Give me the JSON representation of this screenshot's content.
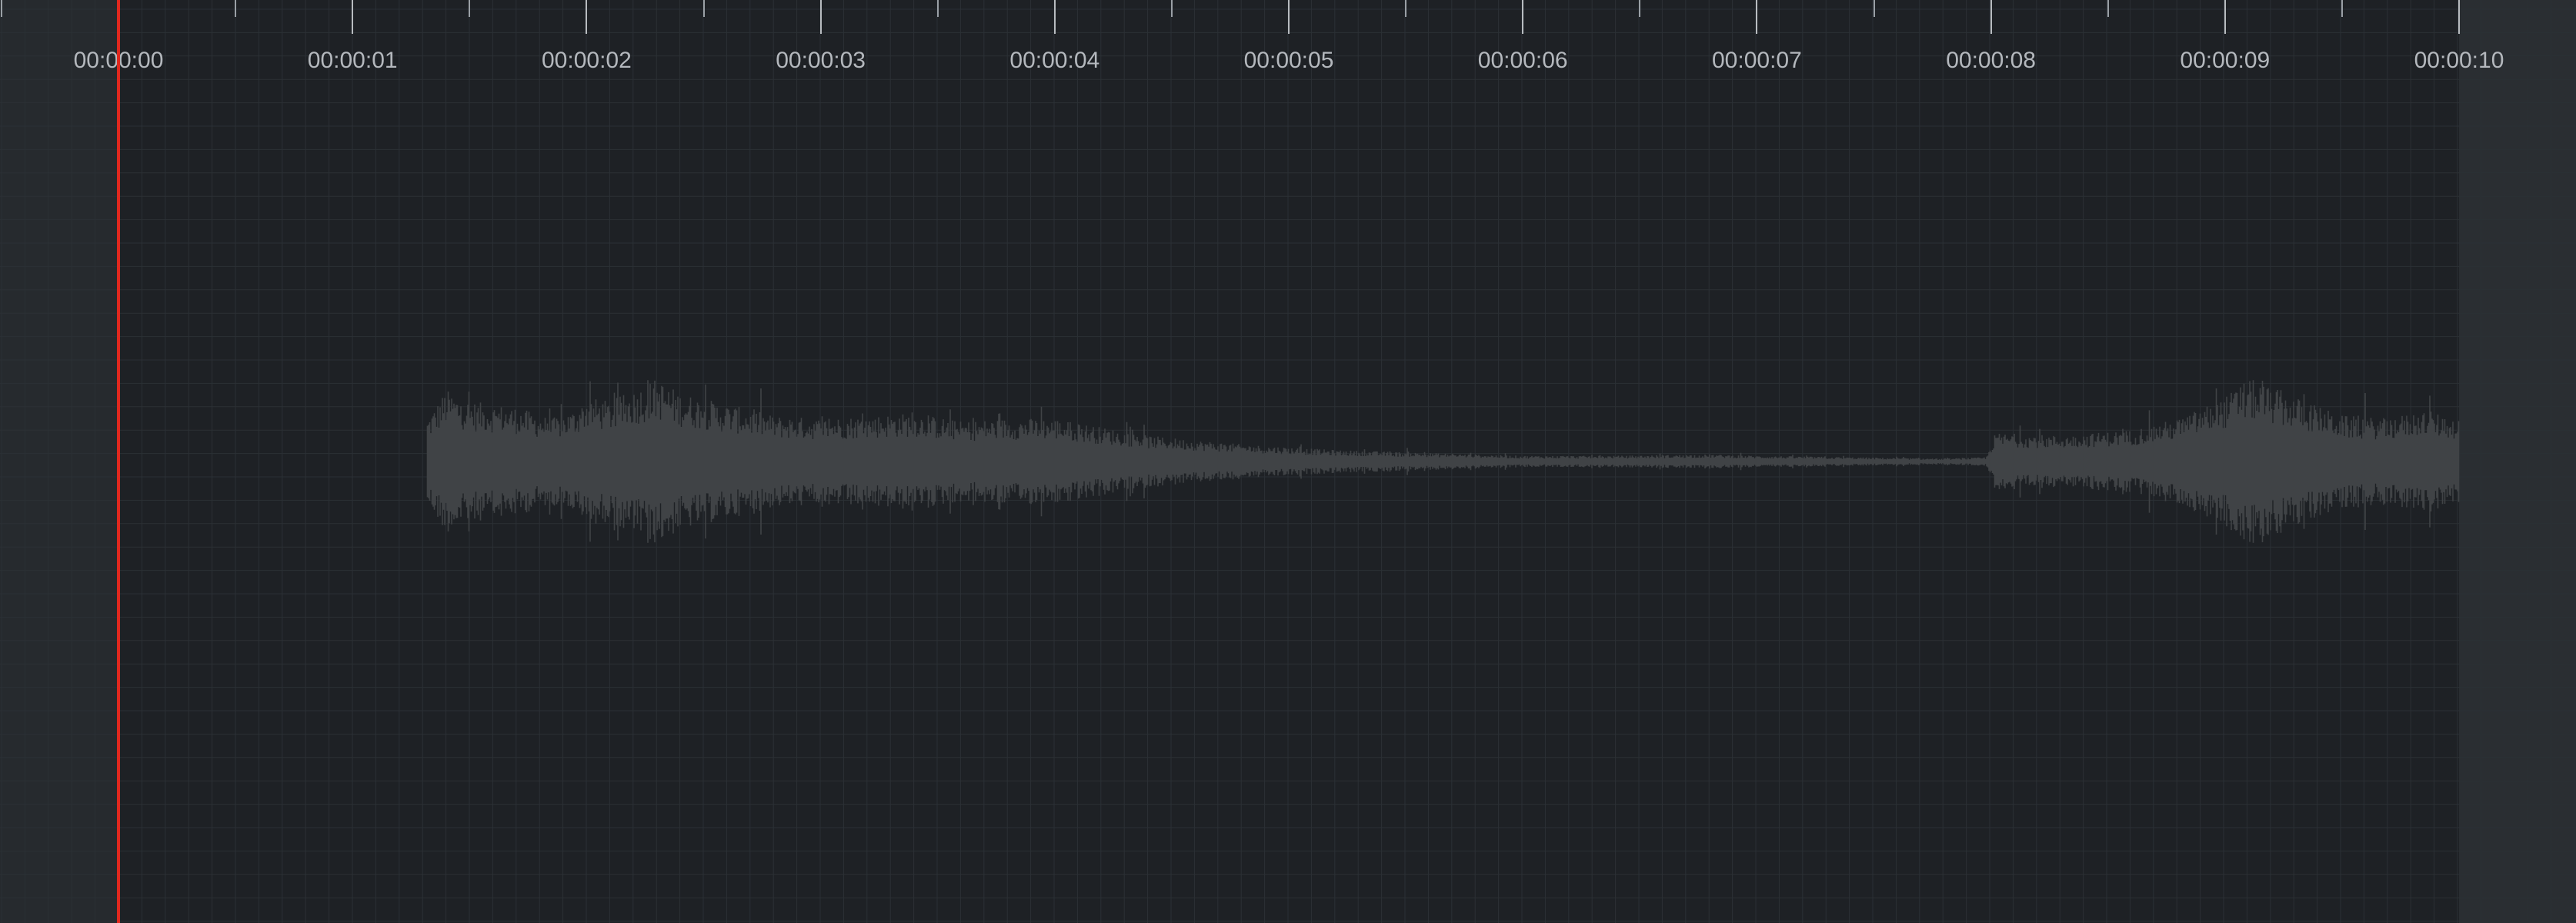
{
  "timeline": {
    "time_labels": [
      "00:00:00",
      "00:00:01",
      "00:00:02",
      "00:00:03",
      "00:00:04",
      "00:00:05",
      "00:00:06",
      "00:00:07",
      "00:00:08",
      "00:00:09",
      "00:00:10"
    ],
    "duration_seconds": 10,
    "minor_ticks_per_second": 2
  },
  "playhead": {
    "position_seconds": 0,
    "color": "#e0281e"
  },
  "waveform": {
    "color": "#404346",
    "audio_start_seconds": 1.32,
    "audio_end_seconds": 10.0,
    "envelope": [
      [
        1.32,
        0.3
      ],
      [
        1.4,
        0.5
      ],
      [
        1.5,
        0.42
      ],
      [
        1.7,
        0.38
      ],
      [
        1.85,
        0.3
      ],
      [
        1.95,
        0.36
      ],
      [
        2.0,
        0.45
      ],
      [
        2.1,
        0.42
      ],
      [
        2.2,
        0.5
      ],
      [
        2.3,
        0.58
      ],
      [
        2.4,
        0.48
      ],
      [
        2.6,
        0.4
      ],
      [
        2.8,
        0.32
      ],
      [
        3.0,
        0.3
      ],
      [
        3.2,
        0.32
      ],
      [
        3.4,
        0.34
      ],
      [
        3.6,
        0.28
      ],
      [
        3.8,
        0.3
      ],
      [
        4.0,
        0.3
      ],
      [
        4.2,
        0.24
      ],
      [
        4.4,
        0.18
      ],
      [
        4.8,
        0.12
      ],
      [
        5.2,
        0.08
      ],
      [
        5.6,
        0.06
      ],
      [
        6.0,
        0.04
      ],
      [
        6.4,
        0.04
      ],
      [
        6.8,
        0.05
      ],
      [
        7.0,
        0.04
      ],
      [
        7.4,
        0.03
      ],
      [
        7.8,
        0.02
      ],
      [
        7.98,
        0.03
      ],
      [
        8.02,
        0.2
      ],
      [
        8.3,
        0.18
      ],
      [
        8.6,
        0.22
      ],
      [
        8.8,
        0.3
      ],
      [
        9.0,
        0.45
      ],
      [
        9.1,
        0.58
      ],
      [
        9.3,
        0.45
      ],
      [
        9.5,
        0.32
      ],
      [
        9.7,
        0.3
      ],
      [
        9.85,
        0.36
      ],
      [
        10.0,
        0.3
      ]
    ]
  },
  "colors": {
    "background": "#1e2125",
    "gridline": "#2b3035",
    "ruler_label": "#b4b8bd",
    "margin_left": "#262a2e",
    "margin_right": "#2a2e32"
  }
}
